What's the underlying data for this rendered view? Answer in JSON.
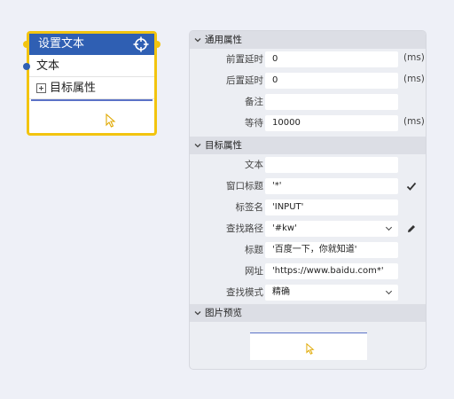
{
  "node": {
    "title": "设置文本",
    "rows": [
      "文本",
      "目标属性"
    ],
    "header_color": "#2f5fb3",
    "border_color": "#f2c40f",
    "icons": [
      "crosshair-icon",
      "expand-plus-icon",
      "pointer-cursor-icon"
    ]
  },
  "panel": {
    "general": {
      "title": "通用属性",
      "delay_before": {
        "label": "前置延时",
        "value": "0",
        "unit": "(ms)"
      },
      "delay_after": {
        "label": "后置延时",
        "value": "0",
        "unit": "(ms)"
      },
      "note": {
        "label": "备注",
        "value": ""
      },
      "wait": {
        "label": "等待",
        "value": "10000",
        "unit": "(ms)"
      }
    },
    "target": {
      "title": "目标属性",
      "text": {
        "label": "文本",
        "value": ""
      },
      "window_title": {
        "label": "窗口标题",
        "value": "'*'"
      },
      "tag_name": {
        "label": "标签名",
        "value": "'INPUT'"
      },
      "find_path": {
        "label": "查找路径",
        "value": "'#kw'"
      },
      "title_field": {
        "label": "标题",
        "value": "'百度一下，你就知道'"
      },
      "url": {
        "label": "网址",
        "value": "'https://www.baidu.com*'"
      },
      "find_mode": {
        "label": "查找模式",
        "value": "精确"
      }
    },
    "preview": {
      "title": "图片预览"
    }
  }
}
